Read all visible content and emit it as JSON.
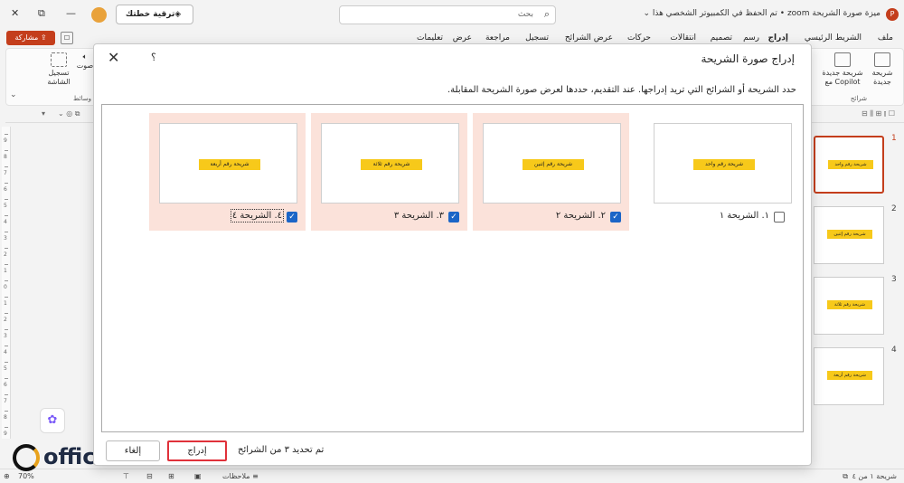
{
  "window": {
    "title": "ميزة صورة الشريحة zoom • تم الحفظ في الكمبيوتر الشخصي هذا ⌄",
    "search_placeholder": "بحث",
    "upgrade_label": "ترقية خطتك",
    "minimize": "—",
    "maximize": "⧉",
    "close": "✕"
  },
  "ribbon_tabs": [
    {
      "label": "ملف"
    },
    {
      "label": "الشريط الرئيسي"
    },
    {
      "label": "إدراج",
      "active": true
    },
    {
      "label": "رسم"
    },
    {
      "label": "تصميم"
    },
    {
      "label": "انتقالات"
    },
    {
      "label": "حركات"
    },
    {
      "label": "عرض الشرائح"
    },
    {
      "label": "تسجيل"
    },
    {
      "label": "مراجعة"
    },
    {
      "label": "عرض"
    },
    {
      "label": "تعليمات"
    }
  ],
  "share_label": "مشاركة",
  "ribbon": {
    "new_slide": "شريحة جديدة",
    "copilot_slide": "شريحة جديدة مع Copilot",
    "slides_group": "شرائح",
    "screen_record": "تسجيل الشاشة",
    "audio": "صوت",
    "media_group": "وسائط"
  },
  "thumbnails": [
    {
      "number": "1",
      "label": "شريحة رقم واحد",
      "selected": true
    },
    {
      "number": "2",
      "label": "شريحة رقم إثنين",
      "selected": false
    },
    {
      "number": "3",
      "label": "شريحة رقم ثلاثة",
      "selected": false
    },
    {
      "number": "4",
      "label": "شريحة رقم أربعة",
      "selected": false
    }
  ],
  "ruler_numbers": [
    "9",
    "8",
    "7",
    "6",
    "5",
    "4",
    "3",
    "2",
    "1",
    "0",
    "1",
    "2",
    "3",
    "4",
    "5",
    "6",
    "7",
    "8",
    "9"
  ],
  "dialog": {
    "title": "إدراج صورة الشريحة",
    "help": "؟",
    "close": "✕",
    "description": "حدد الشريحة أو الشرائح التي تريد إدراجها. عند التقديم، حددها لعرض صورة الشريحة المقابلة.",
    "slides": [
      {
        "label": "شريحة رقم واحد",
        "caption": "١. الشريحة ١",
        "checked": false
      },
      {
        "label": "شريحة رقم إثنين",
        "caption": "٢. الشريحة ٢",
        "checked": true
      },
      {
        "label": "شريحة رقم ثلاثة",
        "caption": "٣. الشريحة ٣",
        "checked": true
      },
      {
        "label": "شريحة رقم أربعة",
        "caption": "٤. الشريحة ٤",
        "checked": true
      }
    ],
    "status": "تم تحديد ٣ من الشرائح",
    "insert_label": "إدراج",
    "cancel_label": "إلغاء"
  },
  "statusbar": {
    "slide_counter": "شريحة ١ من ٤",
    "notes_label": "ملاحظات",
    "zoom": "70%"
  },
  "watermark": "officena.net",
  "colors": {
    "accent": "#c43e1c",
    "selected_card": "#fbe2da",
    "checkbox": "#1b65c7",
    "slide_label": "#f7c91a",
    "insert_border": "#e0313a"
  }
}
